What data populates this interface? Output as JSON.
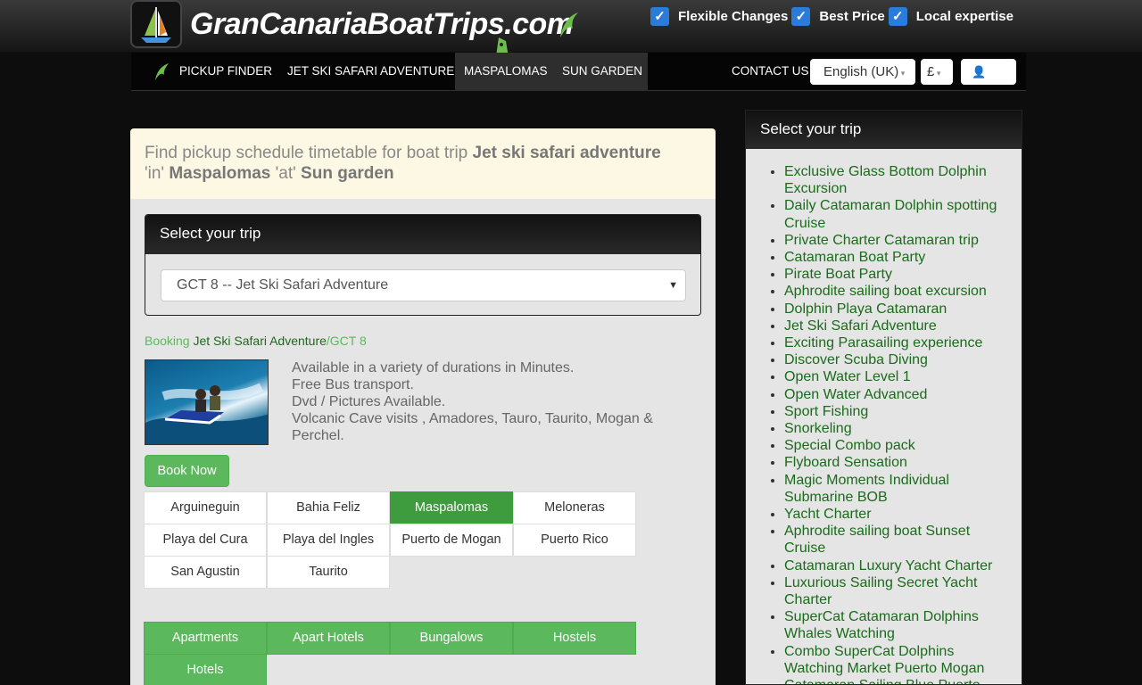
{
  "header": {
    "logo_text": "GranCanariaBoatTrips.com",
    "features": [
      "Flexible Changes",
      "Best Price",
      "Local expertise"
    ]
  },
  "nav": {
    "items": [
      "PICKUP FINDER",
      "JET SKI SAFARI ADVENTURE",
      "MASPALOMAS",
      "SUN GARDEN"
    ],
    "active": "MASPALOMAS",
    "contact": "CONTACT US",
    "language": "English (UK)",
    "currency": "£"
  },
  "banner": {
    "prefix": "Find pickup schedule timetable for boat trip ",
    "trip": "Jet ski safari adventure",
    "in_text": " 'in' ",
    "location": "Maspalomas",
    "at_text": " 'at' ",
    "hotel": "Sun garden"
  },
  "trip_panel": {
    "title": "Select your trip",
    "selected": "GCT 8 -- Jet Ski Safari Adventure"
  },
  "breadcrumb": {
    "booking": "Booking ",
    "trip": "Jet Ski Safari Adventure",
    "code": "/GCT 8"
  },
  "description": [
    "Available in a variety of durations in Minutes.",
    "Free Bus transport.",
    "Dvd / Pictures Available.",
    "Volcanic Cave visits , Amadores, Tauro, Taurito, Mogan & Perchel."
  ],
  "book_button": "Book Now",
  "locations": [
    "Arguineguin",
    "Bahia Feliz",
    "Maspalomas",
    "Meloneras",
    "Playa del Cura",
    "Playa del Ingles",
    "Puerto de Mogan",
    "Puerto Rico",
    "San Agustin",
    "Taurito"
  ],
  "active_location": "Maspalomas",
  "accommodation_types": [
    "Apartments",
    "Apart Hotels",
    "Bungalows",
    "Hostels",
    "Hotels"
  ],
  "sidebar": {
    "title": "Select your trip",
    "trips": [
      "Exclusive Glass Bottom Dolphin Excursion",
      "Daily Catamaran Dolphin spotting Cruise",
      "Private Charter Catamaran trip",
      "Catamaran Boat Party",
      "Pirate Boat Party",
      "Aphrodite sailing boat excursion",
      "Dolphin Playa Catamaran",
      "Jet Ski Safari Adventure",
      "Exciting Parasailing experience",
      "Discover Scuba Diving",
      "Open Water Level 1",
      "Open Water Advanced",
      "Sport Fishing",
      "Snorkeling",
      "Special Combo pack",
      "Flyboard Sensation",
      "Magic Moments Individual Submarine BOB",
      "Yacht Charter",
      "Aphrodite sailing boat Sunset Cruise",
      "Catamaran Luxury Yacht Charter",
      "Luxurious Sailing Secret Yacht Charter",
      "SuperCat Catamaran Dolphins Whales Watching",
      "Combo SuperCat Dolphins Watching Market Puerto Mogan",
      "Catamaran Sailing Blue Puerto"
    ]
  },
  "colors": {
    "accent_green": "#5cb85c",
    "link_green": "#1a6b1a",
    "checkbox_blue": "#2b7bd8",
    "banner_bg": "#fcf8e3"
  }
}
